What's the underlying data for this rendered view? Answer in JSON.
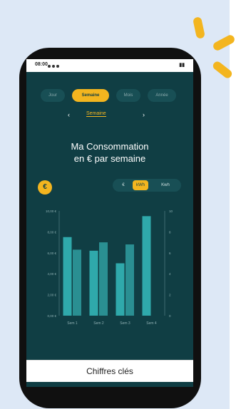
{
  "tabs": [
    "Jour",
    "Semaine",
    "Mois",
    "Année"
  ],
  "active_tab_index": 1,
  "period": {
    "prev": "‹",
    "label": "Semaine",
    "next": "›"
  },
  "title_line1": "Ma Consommation",
  "title_line2": "en € par semaine",
  "euro_symbol": "€",
  "toggle": {
    "left": "€",
    "middle": "kWh",
    "right": "Kwh"
  },
  "chart_data": {
    "type": "bar",
    "categories": [
      "Sem 1",
      "Sem 2",
      "Sem 3",
      "Sem 4"
    ],
    "series": [
      {
        "values": [
          7.5,
          6.2,
          5.0,
          9.5
        ]
      },
      {
        "values": [
          6.3,
          7.0,
          6.8,
          0.0
        ]
      }
    ],
    "ylim": [
      0,
      10
    ],
    "y_ticks_left": [
      "0,00 €",
      "2,00 €",
      "4,00 €",
      "6,00 €",
      "8,00 €",
      "10,00 €"
    ],
    "y_ticks_right": [
      "0",
      "2",
      "4",
      "6",
      "8",
      "10"
    ],
    "grid": false,
    "colors": [
      "#2fa9ab",
      "#2a8f92"
    ]
  },
  "bottom_button": "Chiffres clés",
  "colors": {
    "accent": "#f3b51f",
    "screen_bg": "#103e44"
  }
}
